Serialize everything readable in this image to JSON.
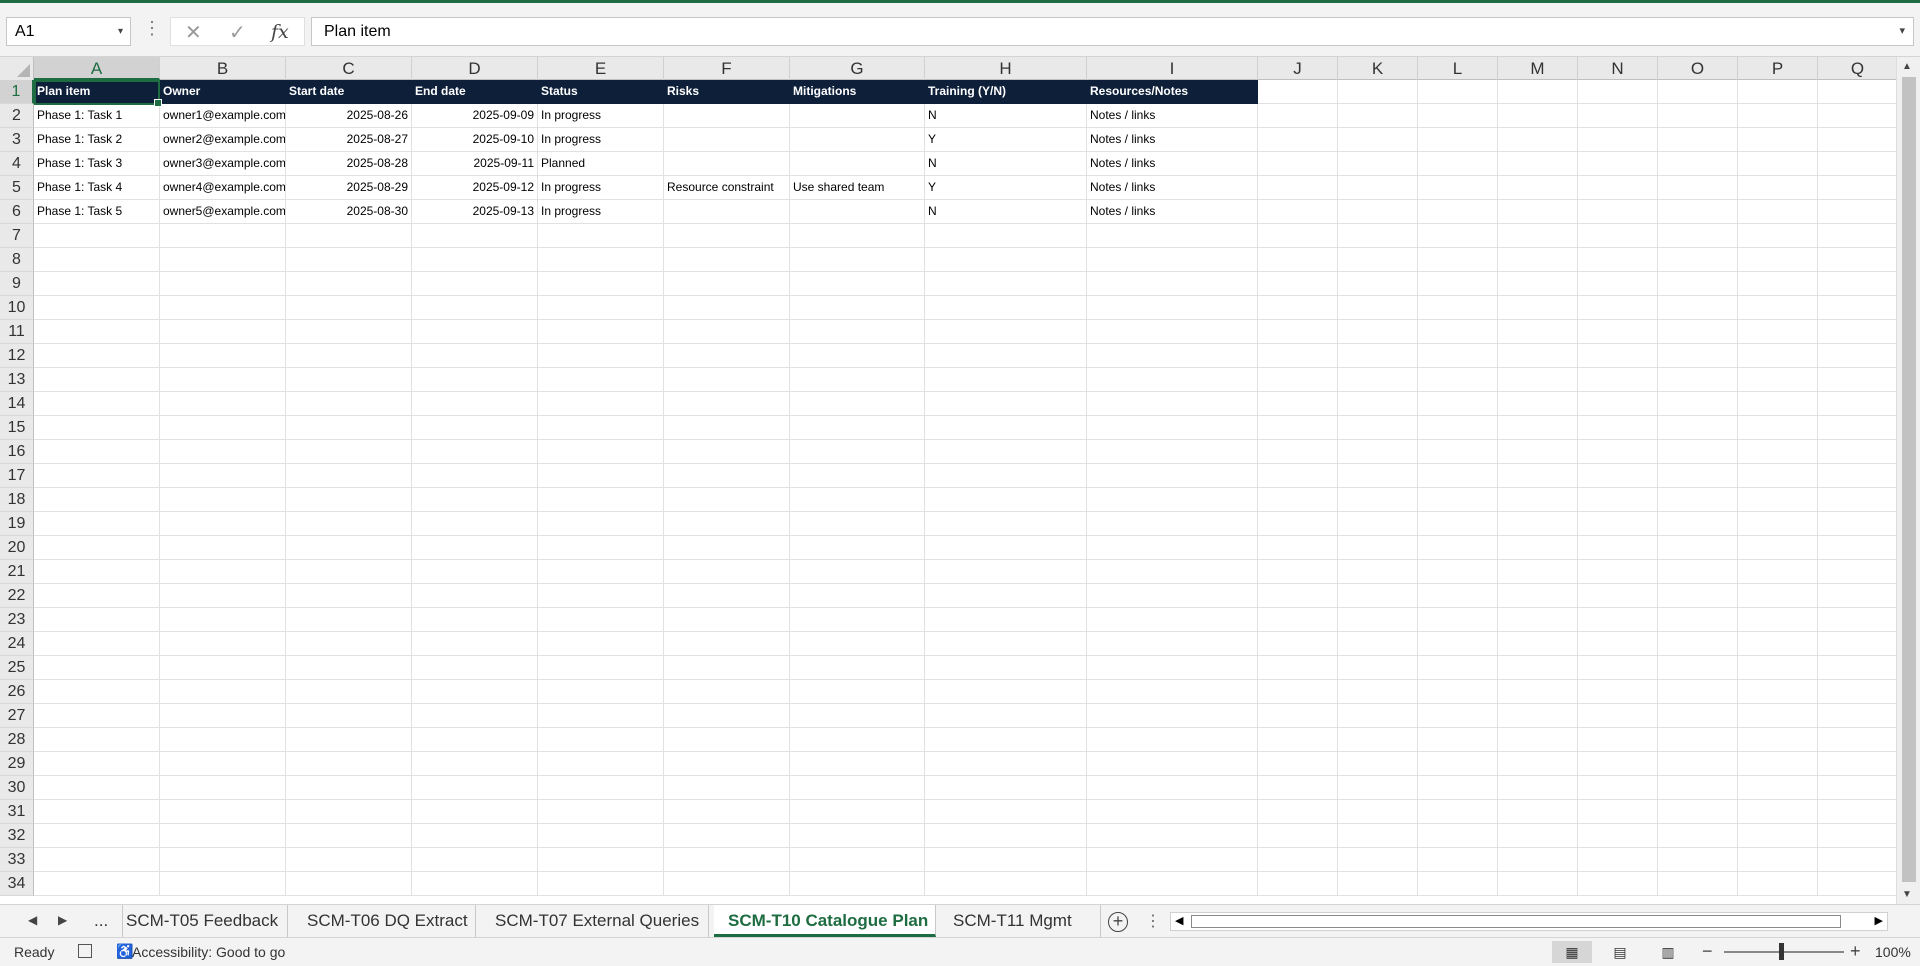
{
  "app": {
    "accent": "#1e6c41",
    "header_fill": "#0e1f39"
  },
  "formula_bar": {
    "name_box": "A1",
    "formula": "Plan item",
    "icons": {
      "dots": "⋮",
      "cancel": "✕",
      "enter": "✓",
      "function": "fx",
      "dropdown": "▾"
    }
  },
  "columns": [
    "A",
    "B",
    "C",
    "D",
    "E",
    "F",
    "G",
    "H",
    "I",
    "J",
    "K",
    "L",
    "M",
    "N",
    "O",
    "P",
    "Q"
  ],
  "rows": [
    "1",
    "2",
    "3",
    "4",
    "5",
    "6",
    "7",
    "8",
    "9",
    "10",
    "11",
    "12",
    "13",
    "14",
    "15",
    "16",
    "17",
    "18",
    "19",
    "20",
    "21",
    "22",
    "23",
    "24",
    "25",
    "26",
    "27",
    "28",
    "29",
    "30",
    "31",
    "32",
    "33",
    "34"
  ],
  "sheet": {
    "header": [
      "Plan item",
      "Owner",
      "Start date",
      "End date",
      "Status",
      "Risks",
      "Mitigations",
      "Training (Y/N)",
      "Resources/Notes"
    ],
    "data": [
      [
        "Phase 1: Task 1",
        "owner1@example.com",
        "2025-08-26",
        "2025-09-09",
        "In progress",
        "",
        "",
        "N",
        "Notes / links"
      ],
      [
        "Phase 1: Task 2",
        "owner2@example.com",
        "2025-08-27",
        "2025-09-10",
        "In progress",
        "",
        "",
        "Y",
        "Notes / links"
      ],
      [
        "Phase 1: Task 3",
        "owner3@example.com",
        "2025-08-28",
        "2025-09-11",
        "Planned",
        "",
        "",
        "N",
        "Notes / links"
      ],
      [
        "Phase 1: Task 4",
        "owner4@example.com",
        "2025-08-29",
        "2025-09-12",
        "In progress",
        "Resource constraint",
        "Use shared team",
        "Y",
        "Notes / links"
      ],
      [
        "Phase 1: Task 5",
        "owner5@example.com",
        "2025-08-30",
        "2025-09-13",
        "In progress",
        "",
        "",
        "N",
        "Notes / links"
      ]
    ]
  },
  "tabs": {
    "ellipsis": "...",
    "items": [
      "SCM-T05 Feedback",
      "SCM-T06 DQ Extract",
      "SCM-T07 External Queries",
      "SCM-T10 Catalogue Plan",
      "SCM-T11 Mgmt"
    ],
    "active_index": 3,
    "more": "..."
  },
  "status": {
    "ready": "Ready",
    "accessibility": "Accessibility: Good to go",
    "zoom": "100%"
  }
}
